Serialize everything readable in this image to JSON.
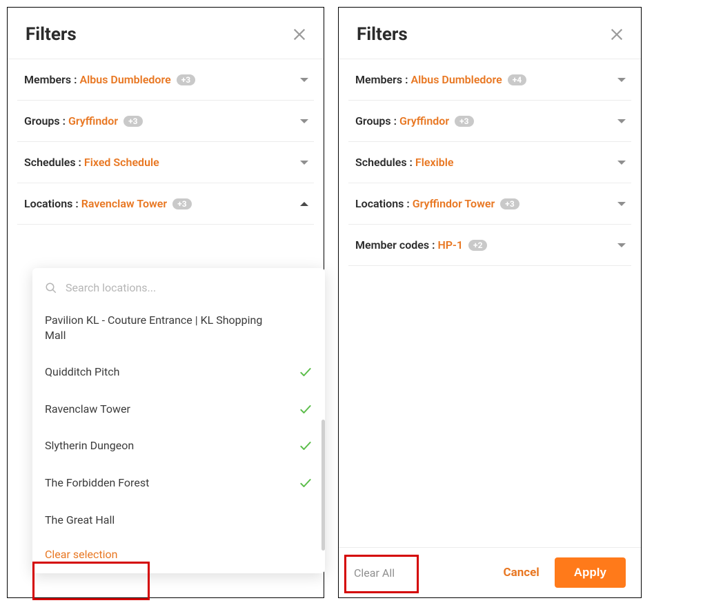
{
  "left": {
    "title": "Filters",
    "members": {
      "label": "Members :",
      "value": "Albus Dumbledore",
      "extra": "+3"
    },
    "groups": {
      "label": "Groups :",
      "value": "Gryffindor",
      "extra": "+3"
    },
    "schedules": {
      "label": "Schedules :",
      "value": "Fixed Schedule"
    },
    "locations": {
      "label": "Locations :",
      "value": "Ravenclaw Tower",
      "extra": "+3"
    },
    "search_placeholder": "Search locations...",
    "options": [
      {
        "label": "Pavilion KL - Couture Entrance | KL Shopping Mall",
        "selected": false
      },
      {
        "label": "Quidditch Pitch",
        "selected": true
      },
      {
        "label": "Ravenclaw Tower",
        "selected": true
      },
      {
        "label": "Slytherin Dungeon",
        "selected": true
      },
      {
        "label": "The Forbidden Forest",
        "selected": true
      },
      {
        "label": "The Great Hall",
        "selected": false
      }
    ],
    "clear_selection": "Clear selection"
  },
  "right": {
    "title": "Filters",
    "members": {
      "label": "Members :",
      "value": "Albus Dumbledore",
      "extra": "+4"
    },
    "groups": {
      "label": "Groups :",
      "value": "Gryffindor",
      "extra": "+3"
    },
    "schedules": {
      "label": "Schedules :",
      "value": "Flexible"
    },
    "locations": {
      "label": "Locations :",
      "value": "Gryffindor Tower",
      "extra": "+3"
    },
    "member_codes": {
      "label": "Member codes :",
      "value": "HP-1",
      "extra": "+2"
    },
    "footer": {
      "clear_all": "Clear All",
      "cancel": "Cancel",
      "apply": "Apply"
    }
  }
}
